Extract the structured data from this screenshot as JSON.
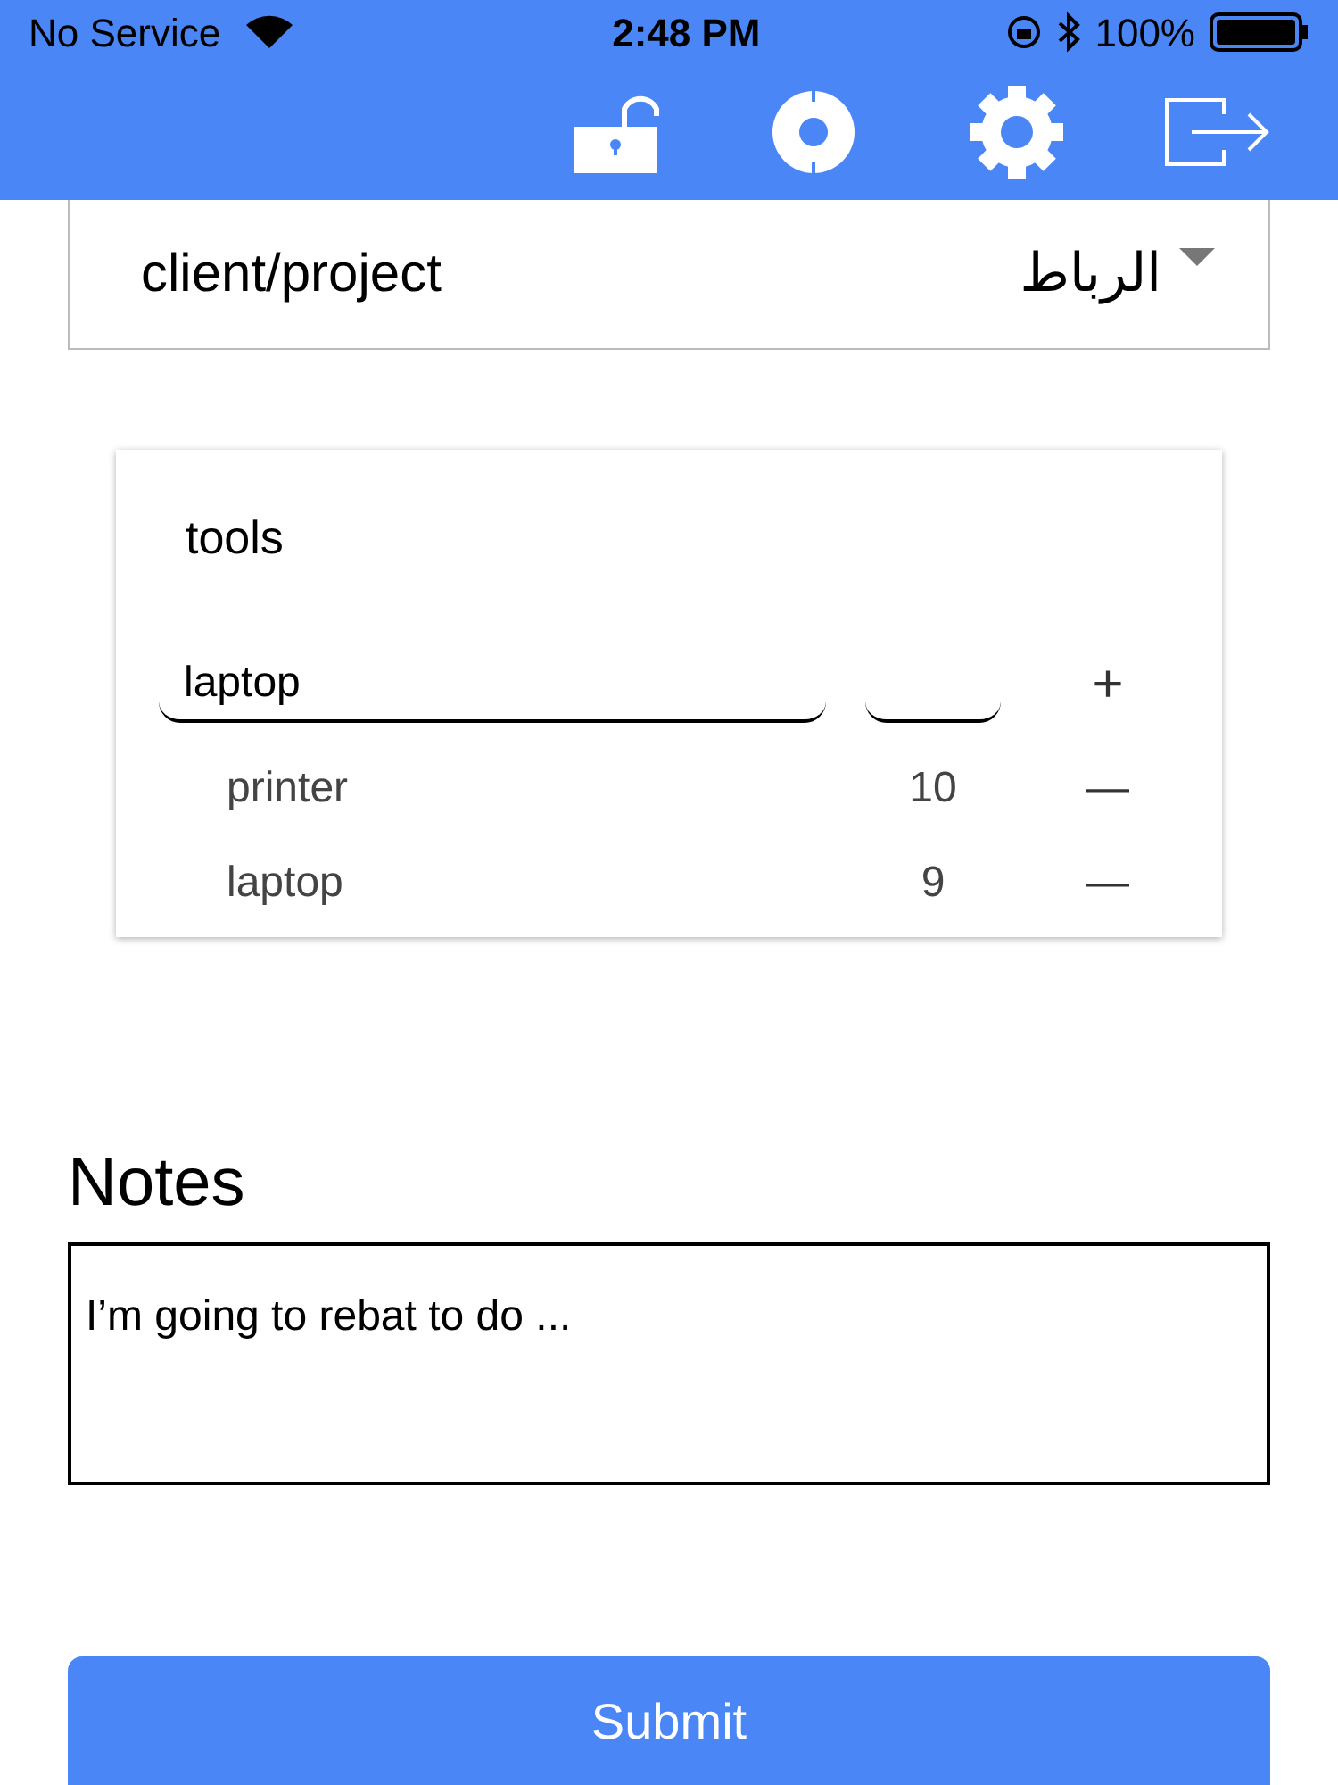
{
  "status_bar": {
    "carrier": "No Service",
    "time": "2:48 PM",
    "battery": "100%"
  },
  "client_project": {
    "label": "client/project",
    "value": "الرباط"
  },
  "tools": {
    "title": "tools",
    "name_input": {
      "value": "laptop"
    },
    "add_button": "+",
    "items": [
      {
        "name": "printer",
        "quantity": "10",
        "remove": "—"
      },
      {
        "name": "laptop",
        "quantity": "9",
        "remove": "—"
      }
    ]
  },
  "notes": {
    "title": "Notes",
    "value": "I’m going to rebat to do ..."
  },
  "submit": "Submit"
}
